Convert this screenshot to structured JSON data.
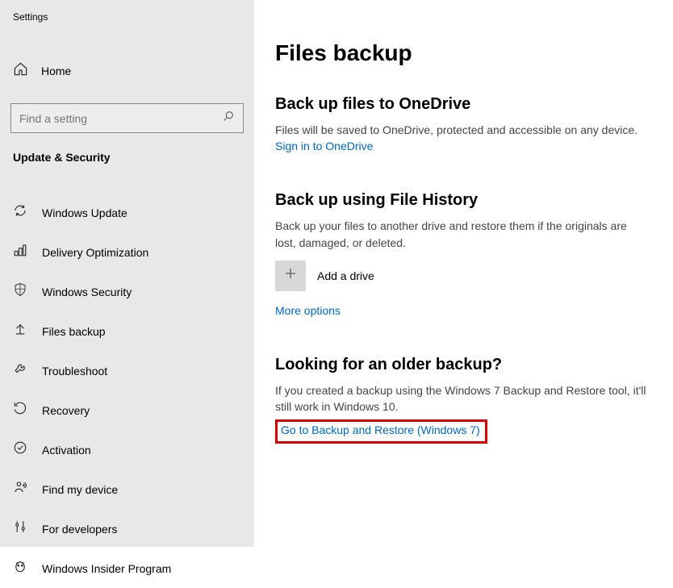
{
  "appTitle": "Settings",
  "home": "Home",
  "searchPlaceholder": "Find a setting",
  "categoryTitle": "Update & Security",
  "navItems": [
    {
      "label": "Windows Update",
      "icon": "refresh-icon"
    },
    {
      "label": "Delivery Optimization",
      "icon": "optimization-icon"
    },
    {
      "label": "Windows Security",
      "icon": "shield-icon"
    },
    {
      "label": "Files backup",
      "icon": "upload-arrow-icon"
    },
    {
      "label": "Troubleshoot",
      "icon": "wrench-icon"
    },
    {
      "label": "Recovery",
      "icon": "recovery-icon"
    },
    {
      "label": "Activation",
      "icon": "check-circle-icon"
    },
    {
      "label": "Find my device",
      "icon": "location-person-icon"
    },
    {
      "label": "For developers",
      "icon": "sliders-icon"
    },
    {
      "label": "Windows Insider Program",
      "icon": "insider-icon"
    }
  ],
  "pageTitle": "Files backup",
  "section1": {
    "title": "Back up files to OneDrive",
    "text": "Files will be saved to OneDrive, protected and accessible on any device.",
    "link": "Sign in to OneDrive"
  },
  "section2": {
    "title": "Back up using File History",
    "text": "Back up your files to another drive and restore them if the originals are lost, damaged, or deleted.",
    "addDrive": "Add a drive",
    "moreOptions": "More options"
  },
  "section3": {
    "title": "Looking for an older backup?",
    "text": "If you created a backup using the Windows 7 Backup and Restore tool, it'll still work in Windows 10.",
    "link": "Go to Backup and Restore (Windows 7)"
  }
}
